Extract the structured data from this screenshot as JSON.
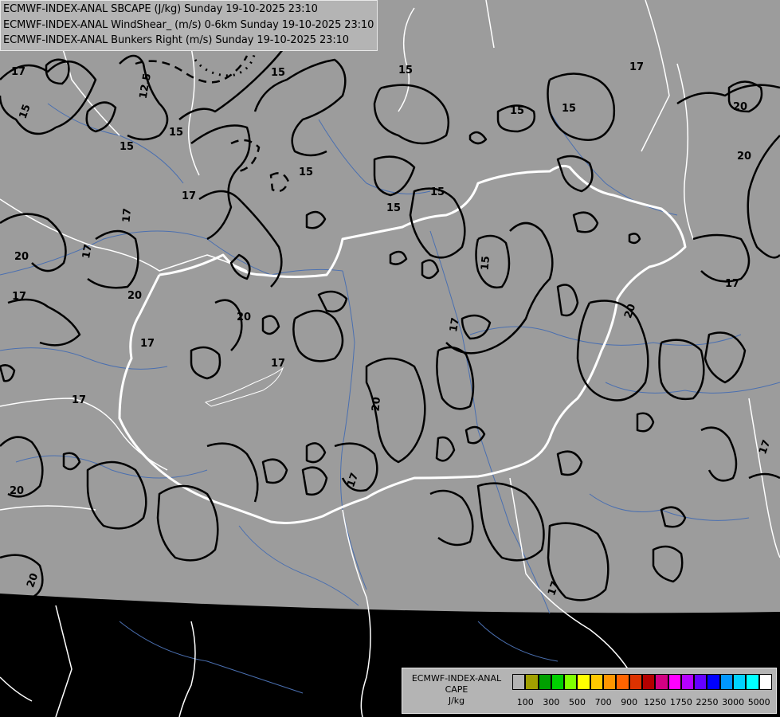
{
  "titles": [
    "ECMWF-INDEX-ANAL SBCAPE (J/kg) Sunday 19-10-2025 23:10",
    "ECMWF-INDEX-ANAL WindShear_ (m/s) 0-6km Sunday 19-10-2025 23:10",
    "ECMWF-INDEX-ANAL Bunkers Right (m/s) Sunday 19-10-2025 23:10"
  ],
  "legend": {
    "line1": "ECMWF-INDEX-ANAL",
    "line2": "CAPE",
    "line3": "J/kg",
    "colors": [
      "#b4b4b4",
      "#a0a000",
      "#00a000",
      "#00d000",
      "#80ff00",
      "#ffff00",
      "#ffc800",
      "#ff9600",
      "#ff6400",
      "#dc3200",
      "#b40000",
      "#d20082",
      "#ff00ff",
      "#b400ff",
      "#6400ff",
      "#0000ff",
      "#0096ff",
      "#00d2ff",
      "#00ffff",
      "#ffffff"
    ],
    "ticks": [
      "100",
      "300",
      "500",
      "700",
      "900",
      "1250",
      "1750",
      "2250",
      "3000",
      "5000"
    ]
  },
  "contour_labels": [
    "17",
    "12.5",
    "15",
    "15",
    "15",
    "15",
    "15",
    "17",
    "20",
    "15",
    "15",
    "20",
    "17",
    "17",
    "20",
    "20",
    "17",
    "17",
    "15",
    "15",
    "15",
    "17",
    "20",
    "17",
    "17",
    "17",
    "20",
    "17",
    "15",
    "20",
    "17",
    "20",
    "17",
    "20",
    "17"
  ],
  "colors": {
    "field": "#9c9c9c",
    "outside": "#000000",
    "borders": "#ffffff",
    "rivers": "#4a6fb0",
    "contours": "#000000"
  }
}
